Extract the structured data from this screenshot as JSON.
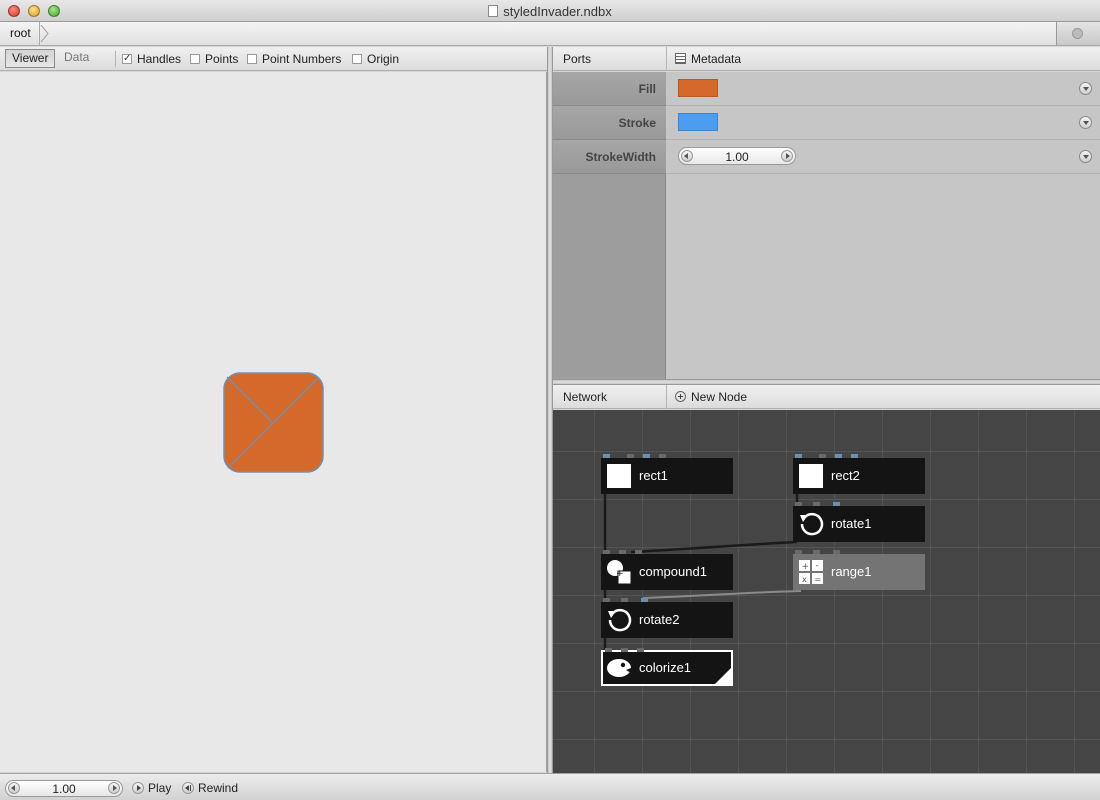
{
  "window": {
    "title": "styledInvader.ndbx"
  },
  "breadcrumb": {
    "root": "root"
  },
  "viewer": {
    "tabs": {
      "viewer": "Viewer",
      "data": "Data"
    },
    "options": [
      {
        "label": "Handles",
        "checked": true
      },
      {
        "label": "Points",
        "checked": false
      },
      {
        "label": "Point Numbers",
        "checked": false
      },
      {
        "label": "Origin",
        "checked": false
      }
    ],
    "shape": {
      "fill": "#d4692a",
      "stroke": "#6f8fb4"
    }
  },
  "ports": {
    "tab_ports": "Ports",
    "tab_metadata": "Metadata",
    "rows": [
      {
        "name": "Fill",
        "type": "color",
        "color": "#d4692a"
      },
      {
        "name": "Stroke",
        "type": "color",
        "color": "#4b9df0"
      },
      {
        "name": "StrokeWidth",
        "type": "number",
        "value": "1.00"
      }
    ]
  },
  "network": {
    "title": "Network",
    "new_node": "New Node",
    "nodes": [
      {
        "id": "rect1",
        "label": "rect1",
        "icon": "rect-icon"
      },
      {
        "id": "rect2",
        "label": "rect2",
        "icon": "rect-icon"
      },
      {
        "id": "rotate1",
        "label": "rotate1",
        "icon": "rotate-icon"
      },
      {
        "id": "compound1",
        "label": "compound1",
        "icon": "compound-icon"
      },
      {
        "id": "range1",
        "label": "range1",
        "icon": "math-icon"
      },
      {
        "id": "rotate2",
        "label": "rotate2",
        "icon": "rotate-icon"
      },
      {
        "id": "colorize1",
        "label": "colorize1",
        "icon": "palette-icon",
        "rendered": true
      }
    ]
  },
  "playback": {
    "frame": "1.00",
    "play": "Play",
    "rewind": "Rewind"
  }
}
